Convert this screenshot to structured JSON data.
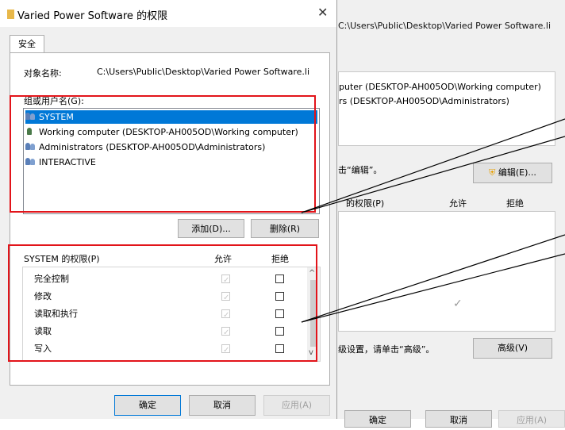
{
  "background_window": {
    "path": "C:\\Users\\Public\\Desktop\\Varied Power Software.li",
    "list_rows": [
      "puter (DESKTOP-AH005OD\\Working computer)",
      "rs (DESKTOP-AH005OD\\Administrators)"
    ],
    "edit_hint": "击“编辑”。",
    "edit_button": "编辑(E)...",
    "perm_header": "的权限(P)",
    "allow_header": "允许",
    "deny_header": "拒绝",
    "checkmark": "✓",
    "advanced_hint": "级设置，请单击“高级”。",
    "advanced_button": "高级(V)",
    "ok_button": "确定",
    "cancel_button": "取消",
    "apply_button": "应用(A)"
  },
  "dialog": {
    "title": "Varied Power Software 的权限",
    "close_glyph": "✕",
    "tab_security": "安全",
    "object_name_label": "对象名称:",
    "object_name_value": "C:\\Users\\Public\\Desktop\\Varied Power Software.li",
    "groups_label": "组或用户名(G):",
    "users": [
      {
        "name": "SYSTEM",
        "icon": "users-group-icon",
        "selected": true
      },
      {
        "name": "Working computer (DESKTOP-AH005OD\\Working computer)",
        "icon": "user-icon",
        "selected": false
      },
      {
        "name": "Administrators (DESKTOP-AH005OD\\Administrators)",
        "icon": "users-group-icon",
        "selected": false
      },
      {
        "name": "INTERACTIVE",
        "icon": "users-group-icon",
        "selected": false
      }
    ],
    "add_button": "添加(D)...",
    "remove_button": "删除(R)",
    "permissions_title": "SYSTEM 的权限(P)",
    "allow_header": "允许",
    "deny_header": "拒绝",
    "permissions": [
      {
        "name": "完全控制",
        "allow": true,
        "deny": false
      },
      {
        "name": "修改",
        "allow": true,
        "deny": false
      },
      {
        "name": "读取和执行",
        "allow": true,
        "deny": false
      },
      {
        "name": "读取",
        "allow": true,
        "deny": false
      },
      {
        "name": "写入",
        "allow": true,
        "deny": false
      }
    ],
    "scroll_up_glyph": "^",
    "scroll_down_glyph": "v",
    "ok_button": "确定",
    "cancel_button": "取消",
    "apply_button": "应用(A)"
  },
  "colors": {
    "selection": "#0078d7",
    "annotation_red": "#e2141a",
    "folder_icon": "#e8b84a"
  }
}
